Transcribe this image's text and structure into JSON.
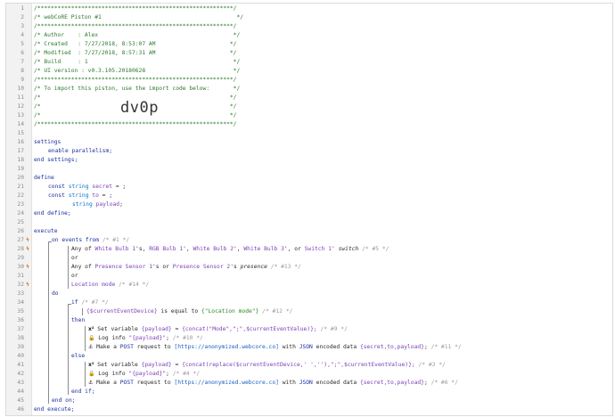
{
  "header": {
    "border": "/**********************************************************/",
    "title": "/* webCoRE Piston #1                                        */",
    "author": "/* Author    : Alex                                        */",
    "created": "/* Created   : 7/27/2018, 8:53:07 AM                      */",
    "modified": "/* Modified  : 7/27/2018, 8:57:31 AM                      */",
    "build": "/* Build     : 1                                           */",
    "ui": "/* UI version : v0.3.105.20180628                          */",
    "import_line": "/* To import this piston, use the import code below:       */",
    "blank_comment": "/*                                                        */",
    "import_code": "dv0p"
  },
  "settings": {
    "kw": "settings",
    "body": "enable parallelism;",
    "end": "end settings;"
  },
  "define": {
    "kw": "define",
    "line1_a": "const ",
    "line1_type": "string",
    "line1_var": " secret",
    "line1_rest": " = ;",
    "line2_a": "const ",
    "line2_type": "string",
    "line2_var": " to",
    "line2_rest": " = ;",
    "line3_type": "string",
    "line3_var": " payload",
    "line3_rest": ";",
    "end": "end define;"
  },
  "execute": {
    "kw": "execute",
    "on_events": "on events from",
    "on_events_cmt": "/* #1 */",
    "any_of": "Any of ",
    "devices1": [
      "White Bulb 1",
      "RGB Bulb 1",
      "White Bulb 2",
      "White Bulb 3",
      "Switch 1"
    ],
    "devices1_sep": [
      "'s, ",
      "', ",
      "', ",
      "', or ",
      "' "
    ],
    "switch": "switch",
    "cmt5": "/* #5 */",
    "or": "or",
    "any_of2": "Any of ",
    "presence1": "Presence Sensor 1",
    "presence_sep": "'s or ",
    "presence2": "Presence Sensor 2",
    "presence_suffix": "'s ",
    "presence_attr": "presence",
    "cmt13": "/* #13 */",
    "location_mode": "Location mode",
    "cmt14": "/* #14 */",
    "do": "do",
    "if": "if",
    "cmt7": "/* #7 */",
    "cond_var": "{$currentEventDevice}",
    "cond_text": " is equal to ",
    "cond_value": "{\"Location mode\"}",
    "cmt12": "/* #12 */",
    "then": "then",
    "set_var": " Set variable ",
    "payload_var": "{payload}",
    "eq": " = ",
    "concat1": "{concat(\"Mode\",\";\",$currentEventValue)};",
    "cmt9": "/* #9 */",
    "log_info": " Log info ",
    "log_payload": "\"{payload}\"",
    "cmt10": "/* #10 */",
    "make_a": " Make a ",
    "post": "POST",
    "request_to": " request to ",
    "url": "[https://anonymized.webcore.co]",
    "with": " with ",
    "json": "JSON",
    "encoded": " encoded data ",
    "data": "{secret,to,payload}",
    "cmt11": "/* #11 */",
    "else": "else",
    "concat2": "{concat(replace($currentEventDevice,' ',''),\";\",$currentEventValue)};",
    "cmt3": "/* #3 */",
    "cmt4": "/* #4 */",
    "cmt6": "/* #6 */",
    "end_if": "end if;",
    "end_on": "end on;",
    "end_execute": "end execute;"
  },
  "line_numbers": [
    "1",
    "2",
    "3",
    "4",
    "5",
    "6",
    "7",
    "8",
    "9",
    "10",
    "11",
    "12",
    "13",
    "14",
    "15",
    "16",
    "17",
    "18",
    "19",
    "20",
    "21",
    "22",
    "23",
    "24",
    "25",
    "26",
    "27",
    "28",
    "29",
    "30",
    "31",
    "32",
    "33",
    "34",
    "35",
    "36",
    "37",
    "38",
    "39",
    "40",
    "41",
    "42",
    "43",
    "44",
    "45",
    "46"
  ],
  "bolt_lines": [
    "27",
    "28",
    "30",
    "32"
  ],
  "colors": {
    "bolt": "#d9731c",
    "comment": "#2d7a2d",
    "keyword": "#1b2fa0",
    "device": "#7a3fb8"
  }
}
